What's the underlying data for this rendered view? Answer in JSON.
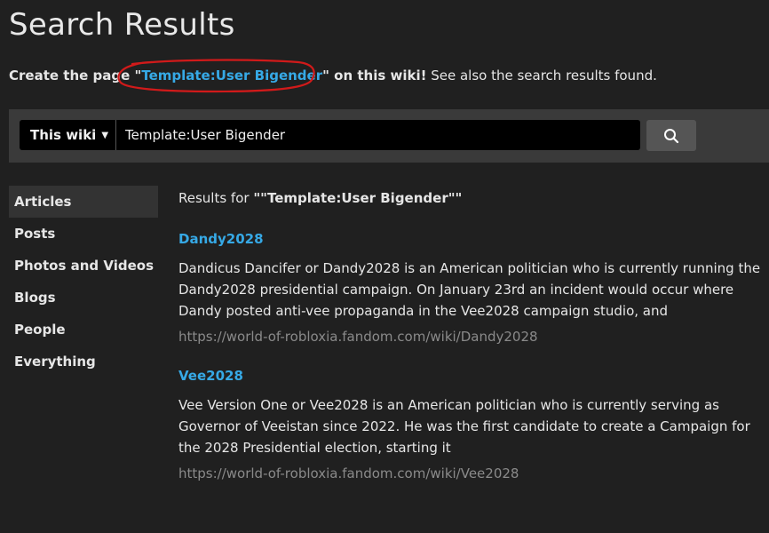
{
  "page": {
    "title": "Search Results"
  },
  "create_notice": {
    "prefix": "Create the page ",
    "quote_open": "\"",
    "link_text": "Template:User Bigender",
    "quote_close": "\"",
    "suffix_bold": " on this wiki!",
    "suffix": " See also the search results found."
  },
  "search": {
    "scope_label": "This wiki",
    "query": "Template:User Bigender",
    "button_icon": "search-icon"
  },
  "sidebar": {
    "items": [
      {
        "label": "Articles",
        "active": true
      },
      {
        "label": "Posts"
      },
      {
        "label": "Photos and Videos"
      },
      {
        "label": "Blogs"
      },
      {
        "label": "People"
      },
      {
        "label": "Everything"
      }
    ]
  },
  "results": {
    "header_prefix": "Results for ",
    "header_query": "\"\"Template:User Bigender\"\"",
    "items": [
      {
        "title": "Dandy2028",
        "snippet": "Dandicus Dancifer or Dandy2028 is an American politician who is currently running the Dandy2028 presidential campaign. On January 23rd an incident would occur where Dandy posted anti-vee propaganda in the Vee2028 campaign studio, and",
        "url": "https://world-of-robloxia.fandom.com/wiki/Dandy2028"
      },
      {
        "title": "Vee2028",
        "snippet": "Vee Version One or Vee2028 is an American politician who is currently serving as Governor of Veeistan since 2022. He was the first candidate to create a Campaign for the 2028 Presidential election, starting it",
        "url": "https://world-of-robloxia.fandom.com/wiki/Vee2028"
      }
    ]
  },
  "colors": {
    "background": "#202020",
    "link": "#36a9e6",
    "annotation_circle": "#d11a1a",
    "url": "#8a8a8a"
  }
}
